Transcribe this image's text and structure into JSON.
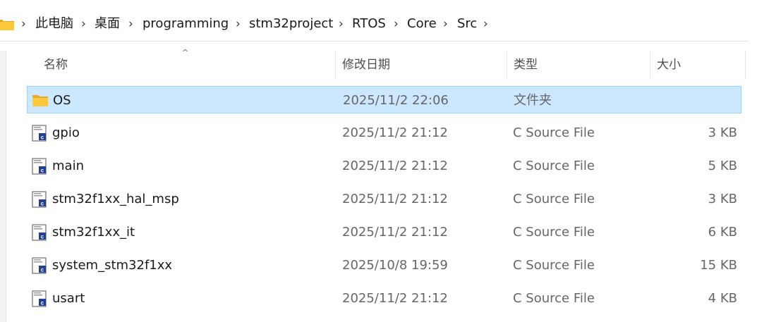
{
  "address_bar": {
    "crumbs": [
      "此电脑",
      "桌面",
      "programming",
      "stm32project",
      "RTOS",
      "Core",
      "Src"
    ]
  },
  "columns": {
    "name": "名称",
    "date": "修改日期",
    "type": "类型",
    "size": "大小"
  },
  "files": [
    {
      "name": "OS",
      "date": "2025/11/2 22:06",
      "type": "文件夹",
      "size": "",
      "icon": "folder-icon",
      "selected": true
    },
    {
      "name": "gpio",
      "date": "2025/11/2 21:12",
      "type": "C Source File",
      "size": "3 KB",
      "icon": "c-source-file-icon"
    },
    {
      "name": "main",
      "date": "2025/11/2 21:12",
      "type": "C Source File",
      "size": "5 KB",
      "icon": "c-source-file-icon"
    },
    {
      "name": "stm32f1xx_hal_msp",
      "date": "2025/11/2 21:12",
      "type": "C Source File",
      "size": "3 KB",
      "icon": "c-source-file-icon"
    },
    {
      "name": "stm32f1xx_it",
      "date": "2025/11/2 21:12",
      "type": "C Source File",
      "size": "6 KB",
      "icon": "c-source-file-icon"
    },
    {
      "name": "system_stm32f1xx",
      "date": "2025/10/8 19:59",
      "type": "C Source File",
      "size": "15 KB",
      "icon": "c-source-file-icon"
    },
    {
      "name": "usart",
      "date": "2025/11/2 21:12",
      "type": "C Source File",
      "size": "4 KB",
      "icon": "c-source-file-icon"
    }
  ],
  "colors": {
    "selection_bg": "#cce8ff",
    "selection_border": "#99d1ff",
    "folder_yellow": "#ffc83d"
  }
}
